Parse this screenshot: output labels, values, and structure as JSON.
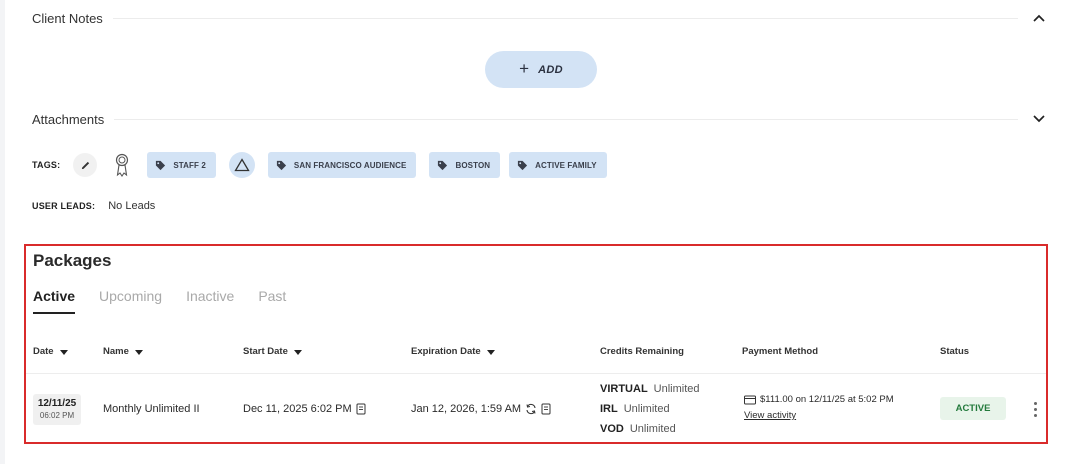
{
  "client_notes": {
    "title": "Client Notes",
    "add_label": "ADD",
    "add_icon": "plus-icon"
  },
  "attachments": {
    "title": "Attachments"
  },
  "tags": {
    "label": "TAGS:",
    "items": [
      {
        "label": "STAFF 2",
        "icon": "tag-icon"
      },
      {
        "label": "SAN FRANCISCO AUDIENCE",
        "icon": "tag-icon"
      },
      {
        "label": "BOSTON",
        "icon": "tag-icon"
      },
      {
        "label": "ACTIVE FAMILY",
        "icon": "tag-icon"
      }
    ]
  },
  "user_leads": {
    "label": "USER LEADS:",
    "value": "No Leads"
  },
  "packages": {
    "title": "Packages",
    "tabs": [
      {
        "label": "Active",
        "active": true
      },
      {
        "label": "Upcoming",
        "active": false
      },
      {
        "label": "Inactive",
        "active": false
      },
      {
        "label": "Past",
        "active": false
      }
    ],
    "columns": {
      "date": "Date",
      "name": "Name",
      "start": "Start Date",
      "expiration": "Expiration Date",
      "credits": "Credits Remaining",
      "payment": "Payment Method",
      "status": "Status"
    },
    "rows": [
      {
        "date": "12/11/25",
        "time": "06:02 PM",
        "name": "Monthly Unlimited II",
        "start": "Dec 11, 2025 6:02 PM",
        "expiration": "Jan 12, 2026, 1:59 AM",
        "credits": [
          {
            "type": "VIRTUAL",
            "value": "Unlimited"
          },
          {
            "type": "IRL",
            "value": "Unlimited"
          },
          {
            "type": "VOD",
            "value": "Unlimited"
          }
        ],
        "payment": "$111.00 on 12/11/25 at 5:02 PM",
        "payment_link": "View activity",
        "status": "ACTIVE"
      }
    ]
  },
  "colors": {
    "accent_blue": "#d3e3f5",
    "highlight_border": "#d92b2b",
    "status_active_bg": "#e8f4ea",
    "status_active_text": "#237a3c"
  }
}
